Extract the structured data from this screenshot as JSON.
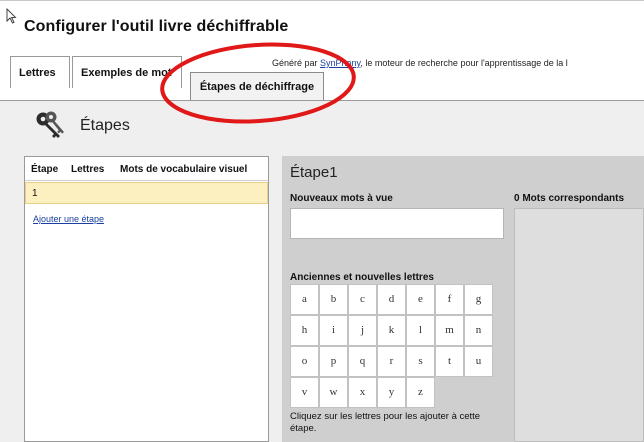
{
  "dialog": {
    "title": "Configurer l'outil livre déchiffrable"
  },
  "tabs": [
    {
      "label": "Lettres"
    },
    {
      "label": "Exemples de mot"
    },
    {
      "label": "Étapes de déchiffrage"
    }
  ],
  "generated_by": {
    "prefix": "Généré par ",
    "link": "SynPhony",
    "suffix": ", le moteur de recherche pour l'apprentissage de la l"
  },
  "section": {
    "heading": "Étapes",
    "icon": "keys-icon"
  },
  "steps_table": {
    "columns": [
      "Étape",
      "Lettres",
      "Mots de vocabulaire visuel"
    ],
    "rows": [
      {
        "step": "1"
      }
    ],
    "add_link": "Ajouter une étape"
  },
  "step_editor": {
    "title": "Étape1",
    "new_words_label": "Nouveaux mots à vue",
    "new_words_value": "",
    "matching_words_label": "0 Mots correspondants",
    "letters_label": "Anciennes et nouvelles lettres",
    "letters": [
      [
        "a",
        "b",
        "c",
        "d",
        "e",
        "f",
        "g"
      ],
      [
        "h",
        "i",
        "j",
        "k",
        "l",
        "m",
        "n"
      ],
      [
        "o",
        "p",
        "q",
        "r",
        "s",
        "t",
        "u"
      ],
      [
        "v",
        "w",
        "x",
        "y",
        "z"
      ]
    ],
    "hint": "Cliquez sur les lettres pour les ajouter à cette étape."
  },
  "colors": {
    "selected_row": "#fcefc0",
    "link": "#1a3fa0",
    "annotation": "#e01818"
  }
}
